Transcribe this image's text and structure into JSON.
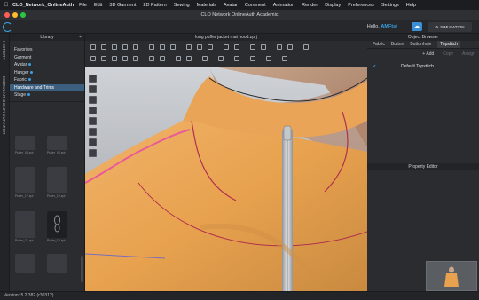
{
  "menubar": {
    "app_name": "CLO_Network_OnlineAuth",
    "items": [
      "File",
      "Edit",
      "3D Garment",
      "2D Pattern",
      "Sewing",
      "Materials",
      "Avatar",
      "Comment",
      "Animation",
      "Render",
      "Display",
      "Preferences",
      "Settings",
      "Help"
    ]
  },
  "window": {
    "title": "CLO Network OnlineAuth Academic"
  },
  "topbar": {
    "greeting": "Hello, ",
    "username": "AMFtst",
    "simulation_label": "SIMULATION"
  },
  "vertical_tabs": {
    "history": "HISTORY",
    "modular": "MODULAR CONFIGURATOR"
  },
  "library": {
    "title": "Library",
    "items": [
      {
        "label": "Favorites",
        "dot": false
      },
      {
        "label": "Garment",
        "dot": false
      },
      {
        "label": "Avatar",
        "dot": true
      },
      {
        "label": "Hanger",
        "dot": true
      },
      {
        "label": "Fabric",
        "dot": true
      },
      {
        "label": "Hardware and Trims",
        "dot": false,
        "selected": true
      },
      {
        "label": "Stage",
        "dot": true
      }
    ],
    "thumbnails": [
      "Puller_03.zpt",
      "Puller_02.zpt",
      "Puller_17.zpt",
      "Puller_19.zpt",
      "Puller_21.zpt",
      "Puller_18.zpt"
    ]
  },
  "viewport": {
    "title": "long puffer jacket mat hood.zprj"
  },
  "object_browser": {
    "title": "Object Browser",
    "tabs": [
      "Fabric",
      "Button",
      "Buttonhole",
      "Topstitch"
    ],
    "active_tab": "Topstitch",
    "add_label": "Add",
    "copy_label": "Copy",
    "assign_label": "Assign",
    "items": [
      "Default Topstitch"
    ]
  },
  "property_editor": {
    "title": "Property Editor"
  },
  "statusbar": {
    "version": "Version: 5.2.382 (r30312)"
  },
  "colors": {
    "accent": "#3aa1e6",
    "garment": "#e8a24f",
    "seam_line": "#b0304d",
    "selected_line": "#e85a9a"
  }
}
